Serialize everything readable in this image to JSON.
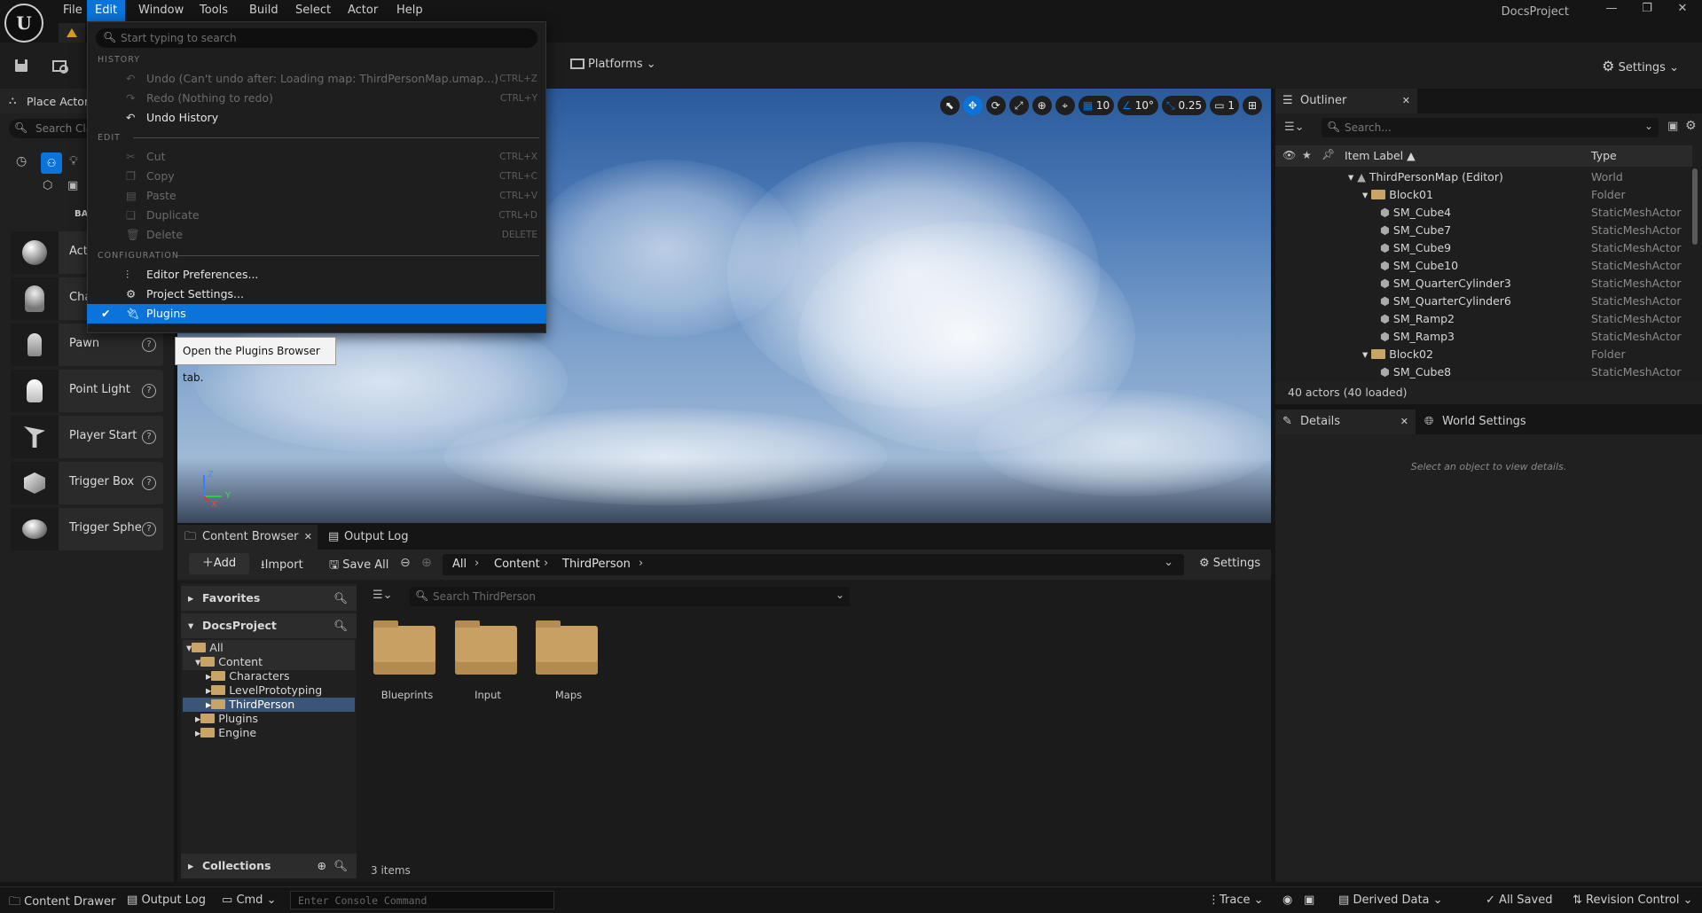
{
  "menubar": {
    "items": [
      "File",
      "Edit",
      "Window",
      "Tools",
      "Build",
      "Select",
      "Actor",
      "Help"
    ],
    "active": "Edit"
  },
  "window": {
    "project_title": "DocsProject",
    "minimize": "—",
    "restore": "❐",
    "close": "✕"
  },
  "toolbar": {
    "platforms_label": "Platforms",
    "settings_label": "Settings"
  },
  "place_actors": {
    "tab_label": "Place Actors",
    "search_placeholder": "Search Cla",
    "category_label": "BA",
    "items": [
      "Act",
      "Cha",
      "Pawn",
      "Point Light",
      "Player Start",
      "Trigger Box",
      "Trigger Sphe"
    ]
  },
  "viewport": {
    "grid_value": "10",
    "angle_value": "10°",
    "scale_value": "0.25",
    "camera_speed": "1",
    "axis_z": "Z",
    "axis_y": "Y",
    "axis_x": "X"
  },
  "outliner": {
    "tab_label": "Outliner",
    "search_placeholder": "Search...",
    "col_label": "Item Label ▲",
    "col_type": "Type",
    "rows": [
      {
        "name": "ThirdPersonMap (Editor)",
        "type": "World"
      },
      {
        "name": "Block01",
        "type": "Folder"
      },
      {
        "name": "SM_Cube4",
        "type": "StaticMeshActor"
      },
      {
        "name": "SM_Cube7",
        "type": "StaticMeshActor"
      },
      {
        "name": "SM_Cube9",
        "type": "StaticMeshActor"
      },
      {
        "name": "SM_Cube10",
        "type": "StaticMeshActor"
      },
      {
        "name": "SM_QuarterCylinder3",
        "type": "StaticMeshActor"
      },
      {
        "name": "SM_QuarterCylinder6",
        "type": "StaticMeshActor"
      },
      {
        "name": "SM_Ramp2",
        "type": "StaticMeshActor"
      },
      {
        "name": "SM_Ramp3",
        "type": "StaticMeshActor"
      },
      {
        "name": "Block02",
        "type": "Folder"
      },
      {
        "name": "SM_Cube8",
        "type": "StaticMeshActor"
      }
    ],
    "status": "40 actors (40 loaded)"
  },
  "details": {
    "tab_details": "Details",
    "tab_world": "World Settings",
    "empty_msg": "Select an object to view details."
  },
  "content_browser": {
    "tab_label": "Content Browser",
    "output_tab": "Output Log",
    "add_label": "Add",
    "import_label": "Import",
    "saveall_label": "Save All",
    "path": [
      "All",
      "Content",
      "ThirdPerson"
    ],
    "settings_label": "Settings",
    "favorites_label": "Favorites",
    "project_label": "DocsProject",
    "tree": [
      "All",
      "Content",
      "Characters",
      "LevelPrototyping",
      "ThirdPerson",
      "Plugins",
      "Engine"
    ],
    "collections_label": "Collections",
    "search_placeholder": "Search ThirdPerson",
    "assets": [
      "Blueprints",
      "Input",
      "Maps"
    ],
    "item_count": "3 items"
  },
  "statusbar": {
    "content_drawer": "Content Drawer",
    "output_log": "Output Log",
    "cmd": "Cmd",
    "console_placeholder": "Enter Console Command",
    "trace": "Trace",
    "derived_data": "Derived Data",
    "all_saved": "All Saved",
    "revision_control": "Revision Control"
  },
  "edit_menu": {
    "search_placeholder": "Start typing to search",
    "sections": {
      "history": "HISTORY",
      "edit": "EDIT",
      "configuration": "CONFIGURATION"
    },
    "undo": {
      "label": "Undo (Can't undo after: Loading map: ThirdPersonMap.umap...)",
      "key": "CTRL+Z"
    },
    "redo": {
      "label": "Redo (Nothing to redo)",
      "key": "CTRL+Y"
    },
    "undo_history": "Undo History",
    "cut": {
      "label": "Cut",
      "key": "CTRL+X"
    },
    "copy": {
      "label": "Copy",
      "key": "CTRL+C"
    },
    "paste": {
      "label": "Paste",
      "key": "CTRL+V"
    },
    "duplicate": {
      "label": "Duplicate",
      "key": "CTRL+D"
    },
    "delete": {
      "label": "Delete",
      "key": "DELETE"
    },
    "editor_prefs": "Editor Preferences...",
    "project_settings": "Project Settings...",
    "plugins": "Plugins",
    "plugins_check": "✔"
  },
  "tooltip": "Open the Plugins Browser tab.",
  "colors": {
    "accent": "#0a74da",
    "folder": "#c9a063",
    "bg": "#151515"
  }
}
